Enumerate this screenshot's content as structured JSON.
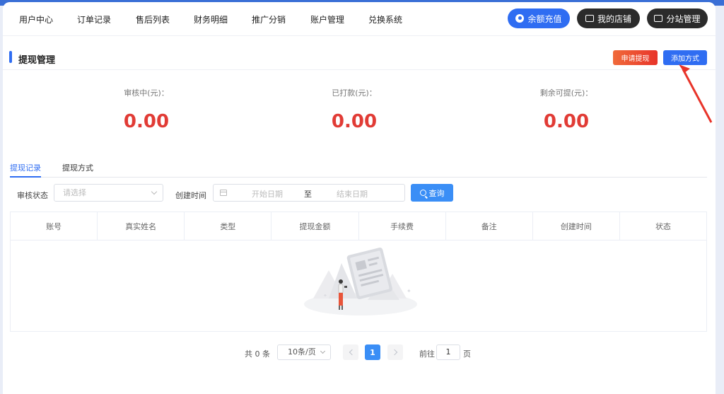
{
  "nav": {
    "items": [
      "用户中心",
      "订单记录",
      "售后列表",
      "财务明细",
      "推广分销",
      "账户管理",
      "兑换系统"
    ],
    "recharge_label": "余额充值",
    "shop_label": "我的店铺",
    "substation_label": "分站管理"
  },
  "section": {
    "title": "提现管理",
    "apply_label": "申请提现",
    "add_method_label": "添加方式"
  },
  "stats": [
    {
      "label": "审核中(元)：",
      "value": "0.00"
    },
    {
      "label": "已打款(元)：",
      "value": "0.00"
    },
    {
      "label": "剩余可提(元)：",
      "value": "0.00"
    }
  ],
  "tabs": [
    "提现记录",
    "提现方式"
  ],
  "filter": {
    "status_label": "审核状态",
    "status_placeholder": "请选择",
    "time_label": "创建时间",
    "start_placeholder": "开始日期",
    "range_sep": "至",
    "end_placeholder": "结束日期",
    "query_label": "查询"
  },
  "table": {
    "columns": [
      "账号",
      "真实姓名",
      "类型",
      "提现金额",
      "手续费",
      "备注",
      "创建时间",
      "状态"
    ]
  },
  "pagination": {
    "total_text": "共 0 条",
    "page_size": "10条/页",
    "current_page": "1",
    "goto_label": "前往",
    "goto_value": "1",
    "page_unit": "页"
  },
  "colors": {
    "primary": "#2f6df2",
    "accent_red": "#e13b35",
    "dark_button": "#2b2b2b"
  }
}
